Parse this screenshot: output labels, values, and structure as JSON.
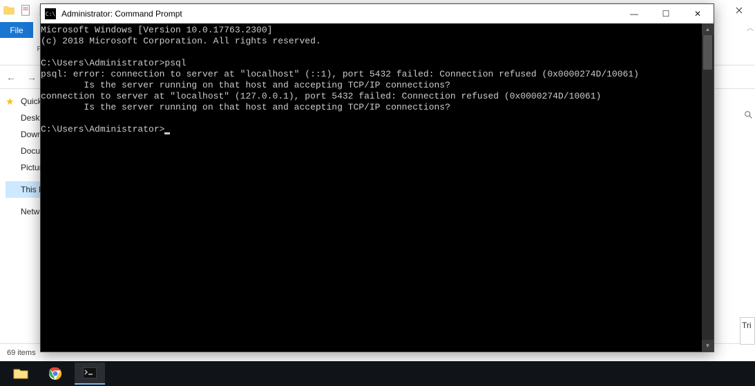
{
  "explorer": {
    "file_tab": "File",
    "ribbon": {
      "pin_group_label": "Pin to Quick access"
    },
    "sidebar": {
      "items": [
        {
          "label": "Quick access"
        },
        {
          "label": "Desktop"
        },
        {
          "label": "Downloads"
        },
        {
          "label": "Documents"
        },
        {
          "label": "Pictures"
        },
        {
          "label": "This PC"
        },
        {
          "label": "Network"
        }
      ]
    },
    "statusbar": {
      "item_count": "69 items"
    },
    "right_controls": {
      "min": "—",
      "max": "☐",
      "close": "✕"
    }
  },
  "right_panel": {
    "text": "Tri"
  },
  "cmd": {
    "title": "Administrator: Command Prompt",
    "icon_text": "C:\\",
    "controls": {
      "min": "—",
      "max": "☐",
      "close": "✕"
    },
    "lines": [
      "Microsoft Windows [Version 10.0.17763.2300]",
      "(c) 2018 Microsoft Corporation. All rights reserved.",
      "",
      "C:\\Users\\Administrator>psql",
      "psql: error: connection to server at \"localhost\" (::1), port 5432 failed: Connection refused (0x0000274D/10061)",
      "        Is the server running on that host and accepting TCP/IP connections?",
      "connection to server at \"localhost\" (127.0.0.1), port 5432 failed: Connection refused (0x0000274D/10061)",
      "        Is the server running on that host and accepting TCP/IP connections?",
      "",
      "C:\\Users\\Administrator>"
    ]
  },
  "taskbar": {
    "items": [
      "file-explorer",
      "chrome",
      "command-prompt"
    ]
  }
}
